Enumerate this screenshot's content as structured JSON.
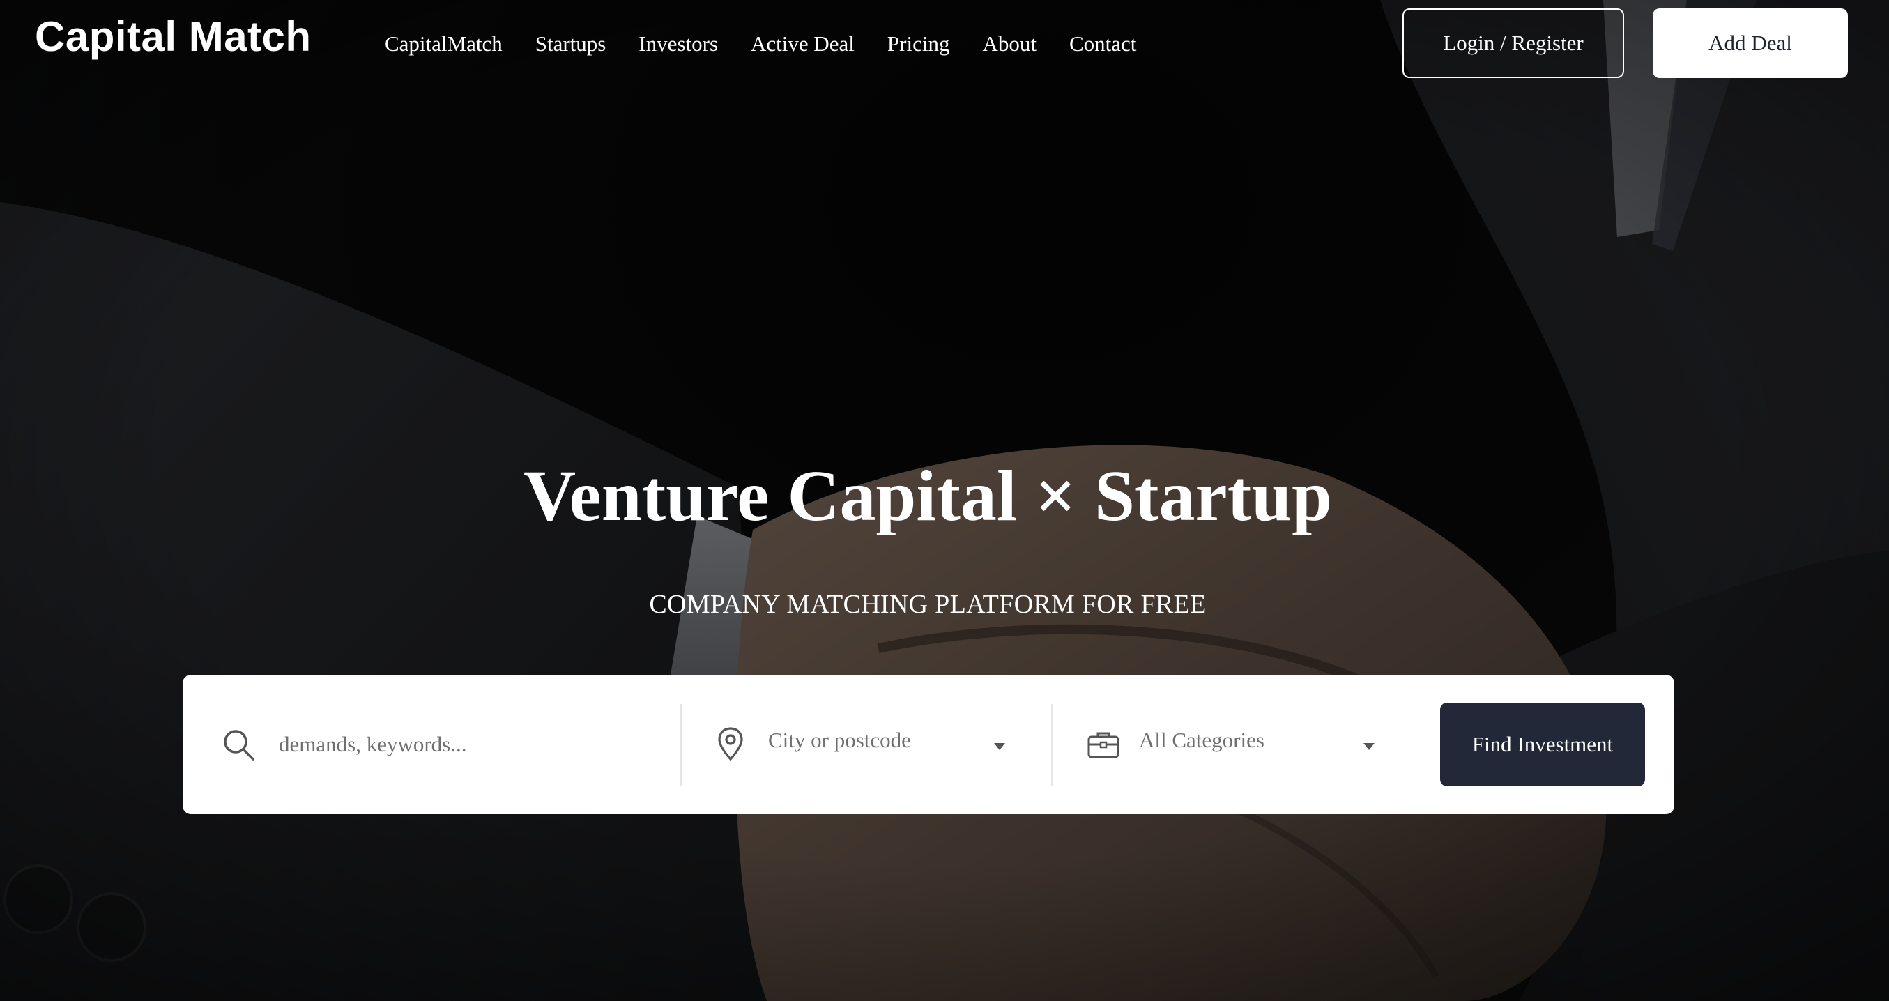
{
  "header": {
    "logo": "Capital Match",
    "nav": [
      "CapitalMatch",
      "Startups",
      "Investors",
      "Active Deal",
      "Pricing",
      "About",
      "Contact"
    ],
    "login_label": "Login / Register",
    "add_deal_label": "Add Deal"
  },
  "hero": {
    "title": "Venture Capital × Startup",
    "subtitle": "COMPANY MATCHING PLATFORM FOR FREE"
  },
  "search": {
    "keywords_placeholder": "demands, keywords...",
    "keywords_value": "",
    "location_selected": "City or postcode",
    "category_selected": "All Categories",
    "submit_label": "Find Investment",
    "icons": [
      "search-icon",
      "map-pin-icon",
      "briefcase-icon",
      "chevron-down-icon"
    ]
  },
  "colors": {
    "accent_button": "#232838",
    "panel": "#ffffff",
    "text_muted": "#6f6f6f"
  }
}
